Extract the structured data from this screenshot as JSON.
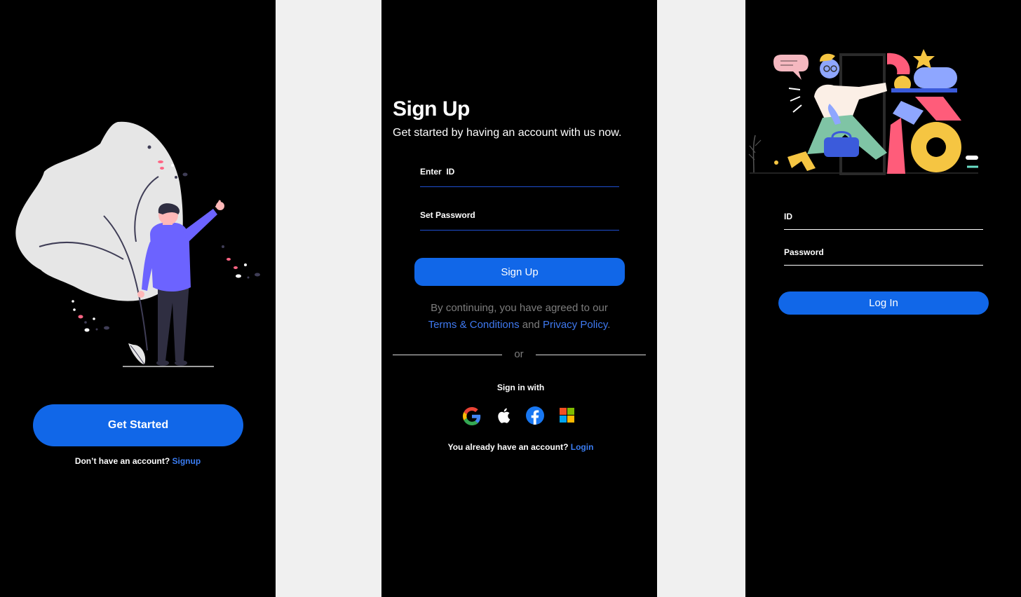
{
  "welcome": {
    "cta_label": "Get Started",
    "footer_prefix": "Don’t have an account?",
    "footer_link": "Signup"
  },
  "signup": {
    "title": "Sign Up",
    "subtitle": "Get started by having an account with us now.",
    "id_label": "Enter  ID",
    "password_label": "Set Password",
    "submit_label": "Sign Up",
    "agree_line1": "By continuing, you have agreed to our",
    "terms_link": "Terms & Conditions",
    "and_word": "and",
    "privacy_link": "Privacy Policy",
    "period": ".",
    "or_text": "or",
    "sign_in_with": "Sign in with",
    "social_providers": [
      "google",
      "apple",
      "facebook",
      "microsoft"
    ],
    "footer_prefix": "You already have an account?",
    "footer_link": "Login"
  },
  "login": {
    "id_label": "ID",
    "password_label": "Password",
    "submit_label": "Log In"
  },
  "colors": {
    "screen_bg": "#000000",
    "canvas_bg": "#f0f0f0",
    "primary": "#1167e8",
    "link": "#3f79f0",
    "muted": "#7d7d7d",
    "accent_purple": "#6c63ff"
  }
}
